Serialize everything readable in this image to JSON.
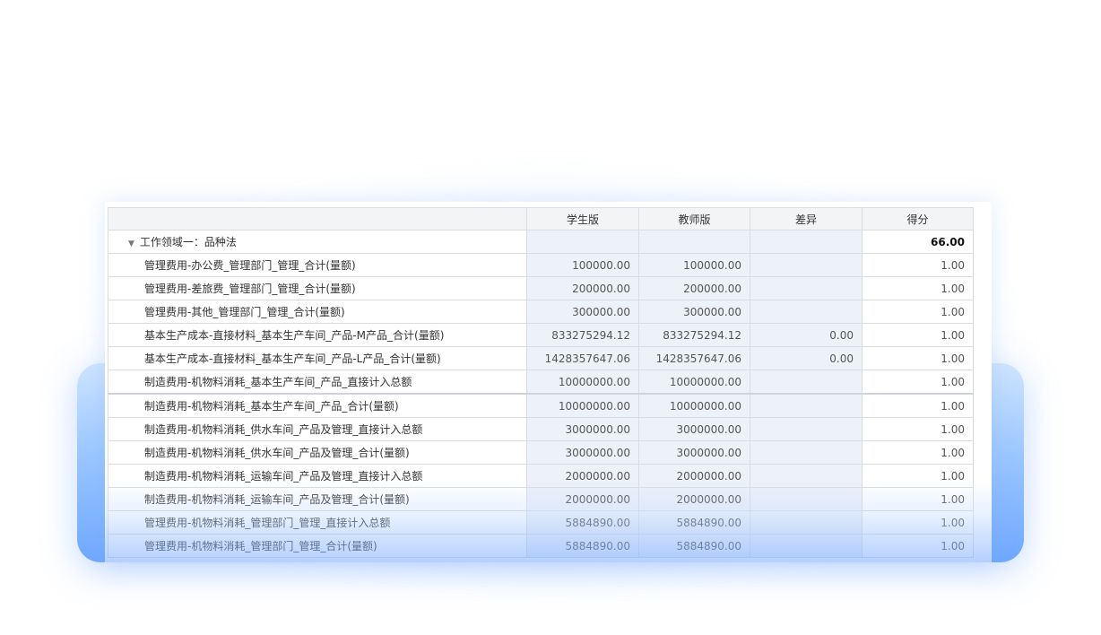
{
  "table": {
    "columns": [
      "",
      "学生版",
      "教师版",
      "差异",
      "得分"
    ],
    "group": {
      "label": "工作领域一：品种法",
      "score": "66.00"
    },
    "rows": [
      {
        "name": "管理费用-办公费_管理部门_管理_合计(量额)",
        "student": "100000.00",
        "teacher": "100000.00",
        "diff": "",
        "score": "1.00"
      },
      {
        "name": "管理费用-差旅费_管理部门_管理_合计(量额)",
        "student": "200000.00",
        "teacher": "200000.00",
        "diff": "",
        "score": "1.00"
      },
      {
        "name": "管理费用-其他_管理部门_管理_合计(量额)",
        "student": "300000.00",
        "teacher": "300000.00",
        "diff": "",
        "score": "1.00"
      },
      {
        "name": "基本生产成本-直接材料_基本生产车间_产品-M产品_合计(量额)",
        "student": "833275294.12",
        "teacher": "833275294.12",
        "diff": "0.00",
        "score": "1.00"
      },
      {
        "name": "基本生产成本-直接材料_基本生产车间_产品-L产品_合计(量额)",
        "student": "1428357647.06",
        "teacher": "1428357647.06",
        "diff": "0.00",
        "score": "1.00"
      },
      {
        "name": "制造费用-机物料消耗_基本生产车间_产品_直接计入总额",
        "student": "10000000.00",
        "teacher": "10000000.00",
        "diff": "",
        "score": "1.00"
      },
      {
        "name": "制造费用-机物料消耗_基本生产车间_产品_合计(量额)",
        "student": "10000000.00",
        "teacher": "10000000.00",
        "diff": "",
        "score": "1.00"
      },
      {
        "name": "制造费用-机物料消耗_供水车间_产品及管理_直接计入总额",
        "student": "3000000.00",
        "teacher": "3000000.00",
        "diff": "",
        "score": "1.00"
      },
      {
        "name": "制造费用-机物料消耗_供水车间_产品及管理_合计(量额)",
        "student": "3000000.00",
        "teacher": "3000000.00",
        "diff": "",
        "score": "1.00"
      },
      {
        "name": "制造费用-机物料消耗_运输车间_产品及管理_直接计入总额",
        "student": "2000000.00",
        "teacher": "2000000.00",
        "diff": "",
        "score": "1.00"
      },
      {
        "name": "制造费用-机物料消耗_运输车间_产品及管理_合计(量额)",
        "student": "2000000.00",
        "teacher": "2000000.00",
        "diff": "",
        "score": "1.00"
      },
      {
        "name": "管理费用-机物料消耗_管理部门_管理_直接计入总额",
        "student": "5884890.00",
        "teacher": "5884890.00",
        "diff": "",
        "score": "1.00"
      },
      {
        "name": "管理费用-机物料消耗_管理部门_管理_合计(量额)",
        "student": "5884890.00",
        "teacher": "5884890.00",
        "diff": "",
        "score": "1.00"
      }
    ]
  }
}
